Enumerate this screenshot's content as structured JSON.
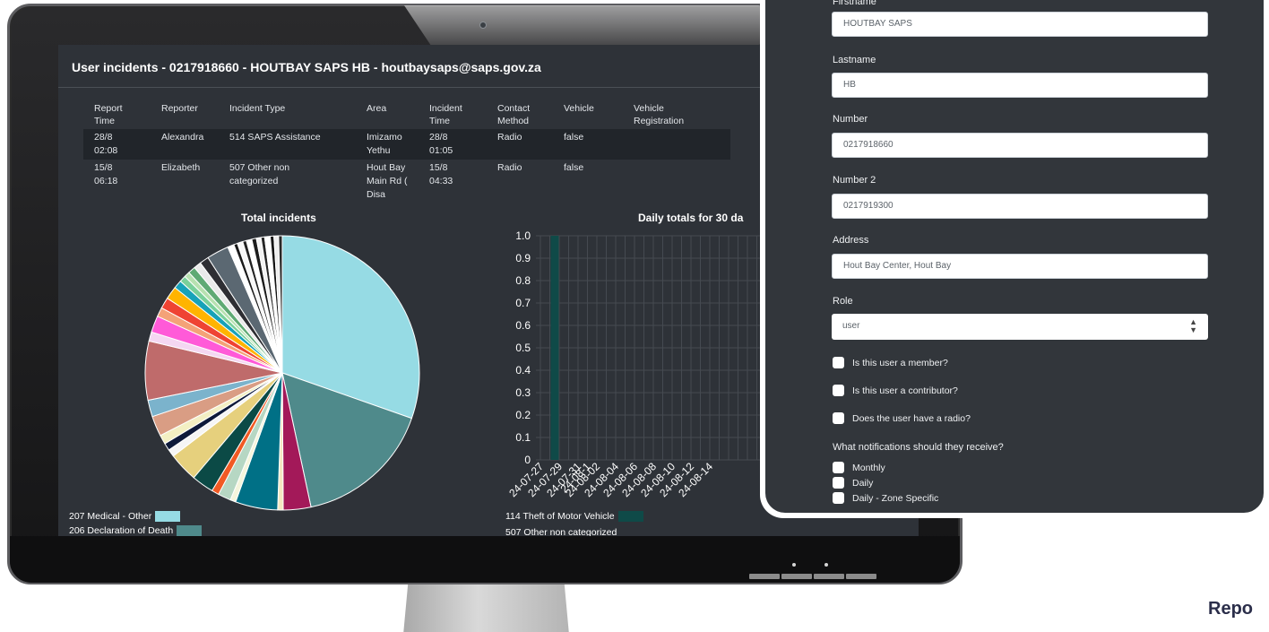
{
  "screen": {
    "title": "User incidents - 0217918660 - HOUTBAY SAPS HB - houtbaysaps@saps.gov.za"
  },
  "incidents_table": {
    "headers": [
      [
        "Report",
        "Time"
      ],
      [
        "Reporter"
      ],
      [
        "Incident Type"
      ],
      [
        "Area"
      ],
      [
        "Incident",
        "Time"
      ],
      [
        "Contact",
        "Method"
      ],
      [
        "Vehicle"
      ],
      [
        "Vehicle",
        "Registration"
      ]
    ],
    "rows": [
      {
        "report_time": [
          "28/8",
          "02:08"
        ],
        "reporter": "Alexandra",
        "incident_type": "514 SAPS Assistance",
        "area": [
          "Imizamo",
          "Yethu"
        ],
        "incident_time": [
          "28/8",
          "01:05"
        ],
        "contact_method": "Radio",
        "vehicle": "false",
        "vehicle_registration": ""
      },
      {
        "report_time": [
          "15/8",
          "06:18"
        ],
        "reporter": "Elizabeth",
        "incident_type": [
          "507 Other non",
          "categorized"
        ],
        "area": [
          "Hout Bay",
          "Main Rd (",
          "Disa"
        ],
        "incident_time": [
          "15/8",
          "04:33"
        ],
        "contact_method": "Radio",
        "vehicle": "false",
        "vehicle_registration": ""
      }
    ]
  },
  "chart_data": [
    {
      "type": "pie",
      "title": "Total incidents",
      "slices": [
        {
          "label": "207 Medical - Other",
          "value": 28.0,
          "color": "#96dbe4"
        },
        {
          "label": "206 Declaration of Death",
          "value": 15.0,
          "color": "#4f8a8b"
        },
        {
          "label": "",
          "value": 3.0,
          "color": "#a31959"
        },
        {
          "label": "",
          "value": 0.6,
          "color": "#f4e8c1"
        },
        {
          "label": "",
          "value": 4.6,
          "color": "#007086"
        },
        {
          "label": "",
          "value": 0.6,
          "color": "#f5f5dc"
        },
        {
          "label": "",
          "value": 1.4,
          "color": "#b6d7c3"
        },
        {
          "label": "",
          "value": 0.8,
          "color": "#f15a24"
        },
        {
          "label": "",
          "value": 2.4,
          "color": "#0b4a46"
        },
        {
          "label": "",
          "value": 3.2,
          "color": "#e6d07d"
        },
        {
          "label": "",
          "value": 0.8,
          "color": "#f5f5f5"
        },
        {
          "label": "",
          "value": 0.8,
          "color": "#0e1a3a"
        },
        {
          "label": "",
          "value": 1.0,
          "color": "#f3efc3"
        },
        {
          "label": "",
          "value": 2.2,
          "color": "#d99d84"
        },
        {
          "label": "",
          "value": 1.8,
          "color": "#7bb3cc"
        },
        {
          "label": "",
          "value": 6.4,
          "color": "#bf6b6b"
        },
        {
          "label": "",
          "value": 1.0,
          "color": "#f4d7f2"
        },
        {
          "label": "",
          "value": 1.8,
          "color": "#ff5ad8"
        },
        {
          "label": "",
          "value": 1.0,
          "color": "#f4a278"
        },
        {
          "label": "",
          "value": 1.2,
          "color": "#ef4333"
        },
        {
          "label": "",
          "value": 1.4,
          "color": "#ffb400"
        },
        {
          "label": "",
          "value": 0.9,
          "color": "#17a2b8"
        },
        {
          "label": "",
          "value": 0.7,
          "color": "#7ad09a"
        },
        {
          "label": "",
          "value": 0.6,
          "color": "#b7e1b0"
        },
        {
          "label": "",
          "value": 0.8,
          "color": "#5faa74"
        },
        {
          "label": "",
          "value": 0.8,
          "color": "#eaeaea"
        },
        {
          "label": "",
          "value": 1.0,
          "color": "#2e2e33"
        },
        {
          "label": "",
          "value": 2.4,
          "color": "#5b6872"
        },
        {
          "label": "",
          "value": 0.7,
          "color": "#ffffff"
        },
        {
          "label": "",
          "value": 0.4,
          "color": "#1a1a1a"
        },
        {
          "label": "",
          "value": 0.6,
          "color": "#f7f7f7"
        },
        {
          "label": "",
          "value": 0.4,
          "color": "#222222"
        },
        {
          "label": "",
          "value": 0.6,
          "color": "#ffffff"
        },
        {
          "label": "",
          "value": 0.5,
          "color": "#1c1c1c"
        },
        {
          "label": "",
          "value": 0.5,
          "color": "#f2f2f2"
        },
        {
          "label": "",
          "value": 0.4,
          "color": "#262626"
        },
        {
          "label": "",
          "value": 0.6,
          "color": "#ffffff"
        },
        {
          "label": "",
          "value": 0.4,
          "color": "#141414"
        },
        {
          "label": "",
          "value": 0.5,
          "color": "#eeeeee"
        },
        {
          "label": "",
          "value": 0.4,
          "color": "#2a2a2a"
        }
      ],
      "legend": [
        {
          "label": "207 Medical - Other",
          "color": "#96dbe4"
        },
        {
          "label": "206 Declaration of Death",
          "color": "#4f8a8b"
        }
      ]
    },
    {
      "type": "bar",
      "title": "Daily totals for 30 da",
      "x": [
        "24-07-27",
        "24-07-29",
        "24-07-31",
        "24-08-02",
        "24-08-04",
        "24-08-06",
        "24-08-08",
        "24-08-10",
        "24-08-12",
        "24-08-14",
        "24-08-1"
      ],
      "y_ticks": [
        "1.0",
        "0.9",
        "0.8",
        "0.7",
        "0.6",
        "0.5",
        "0.4",
        "0.3",
        "0.2",
        "0.1",
        "0"
      ],
      "ylim": [
        0,
        1.0
      ],
      "series": [
        {
          "name": "114 Theft of Motor Vehicle",
          "color": "#0f4a48",
          "points": [
            {
              "date": "24-07-28",
              "value": 1.0
            }
          ]
        }
      ],
      "legend": [
        {
          "label": "114 Theft of Motor Vehicle",
          "color": "#0f4a48"
        },
        {
          "label": "507 Other non categorized",
          "color": ""
        }
      ],
      "grid": true
    }
  ],
  "form": {
    "firstname_label": "Firstname",
    "firstname_value": "HOUTBAY SAPS",
    "lastname_label": "Lastname",
    "lastname_value": "HB",
    "number_label": "Number",
    "number_value": "0217918660",
    "number2_label": "Number 2",
    "number2_value": "0217919300",
    "address_label": "Address",
    "address_value": "Hout Bay Center, Hout Bay",
    "role_label": "Role",
    "role_value": "user",
    "member_label": "Is this user a member?",
    "contributor_label": "Is this user a contributor?",
    "radio_label": "Does the user have a radio?",
    "notifications_label": "What notifications should they receive?",
    "notifications": [
      "Monthly",
      "Daily",
      "Daily - Zone Specific"
    ]
  },
  "page": {
    "report_text": "Repo"
  },
  "colors": {
    "screen_bg": "#2e3238",
    "panel_bg": "#32363b"
  }
}
